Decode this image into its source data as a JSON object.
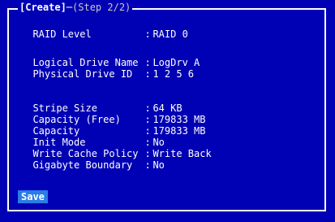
{
  "window": {
    "title": "[Create]",
    "step": "(Step 2/2)"
  },
  "fields": [
    {
      "label": "RAID Level",
      "value": "RAID 0"
    },
    {
      "label": "Logical Drive Name",
      "value": "LogDrv A"
    },
    {
      "label": "Physical Drive ID",
      "value": "1 2 5 6"
    },
    {
      "label": "Stripe Size",
      "value": "64 KB"
    },
    {
      "label": "Capacity (Free)",
      "value": "179833 MB"
    },
    {
      "label": "Capacity",
      "value": "179833 MB"
    },
    {
      "label": "Init Mode",
      "value": "No"
    },
    {
      "label": "Write Cache Policy",
      "value": "Write Back"
    },
    {
      "label": "Gigabyte Boundary",
      "value": "No"
    }
  ],
  "separator": ":",
  "actions": {
    "save_label": "Save"
  },
  "colors": {
    "background": "#0000b4",
    "button": "#2a7ce6",
    "text": "#ffffff"
  }
}
